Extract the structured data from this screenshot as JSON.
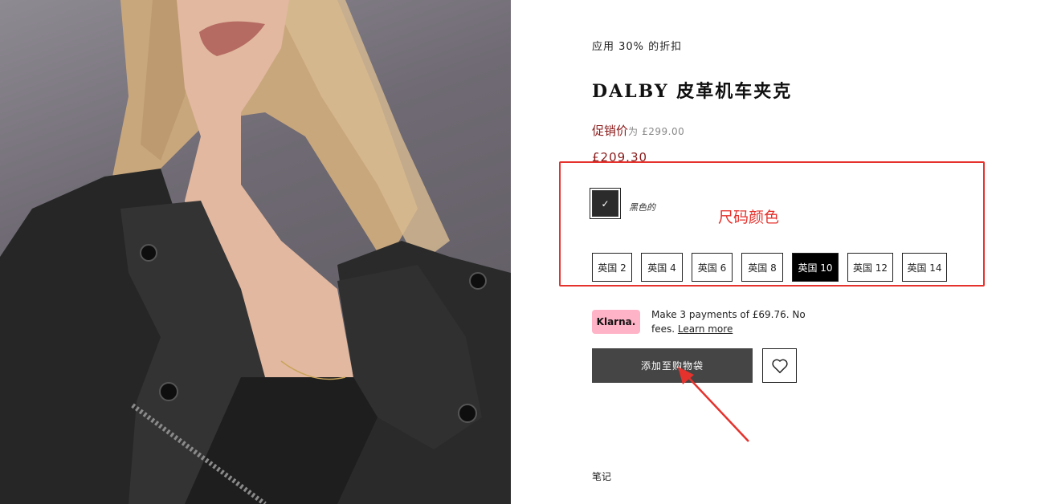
{
  "promo": {
    "discount_text": "应用 30% 的折扣"
  },
  "product": {
    "title": "DALBY 皮革机车夹克",
    "sale_label": "促销价",
    "was_prefix": "为",
    "was_price": "£299.00",
    "now_price": "£209.30"
  },
  "color": {
    "name": "黑色的",
    "check_icon": "✓",
    "swatch_color": "#2b2b2b"
  },
  "sizes": {
    "options": [
      "英国 2",
      "英国 4",
      "英国 6",
      "英国 8",
      "英国 10",
      "英国 12",
      "英国 14"
    ],
    "selected": "英国 10"
  },
  "annotation": {
    "label": "尺码颜色",
    "color": "#e5322d"
  },
  "klarna": {
    "badge": "Klarna.",
    "message": "Make 3 payments of £69.76. No fees.",
    "link": "Learn more"
  },
  "actions": {
    "add_to_bag": "添加至购物袋"
  },
  "notes": {
    "label": "笔记"
  }
}
